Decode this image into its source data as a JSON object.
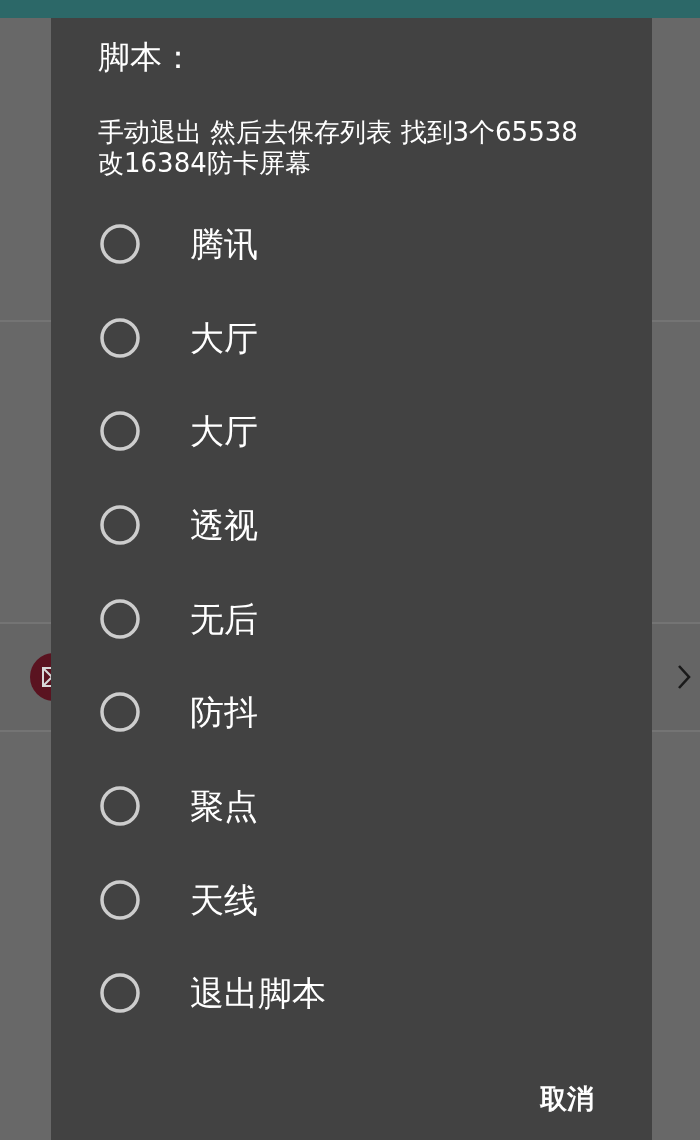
{
  "dialog": {
    "title": "脚本：",
    "message": "手动退出 然后去保存列表 找到3个65538\n改16384防卡屏幕",
    "options": [
      {
        "label": "腾讯",
        "selected": false
      },
      {
        "label": "大厅",
        "selected": false
      },
      {
        "label": "大厅",
        "selected": false
      },
      {
        "label": "透视",
        "selected": false
      },
      {
        "label": "无后",
        "selected": false
      },
      {
        "label": "防抖",
        "selected": false
      },
      {
        "label": "聚点",
        "selected": false
      },
      {
        "label": "天线",
        "selected": false
      },
      {
        "label": "退出脚本",
        "selected": false
      }
    ],
    "buttons": [
      {
        "label": "取消"
      }
    ]
  }
}
